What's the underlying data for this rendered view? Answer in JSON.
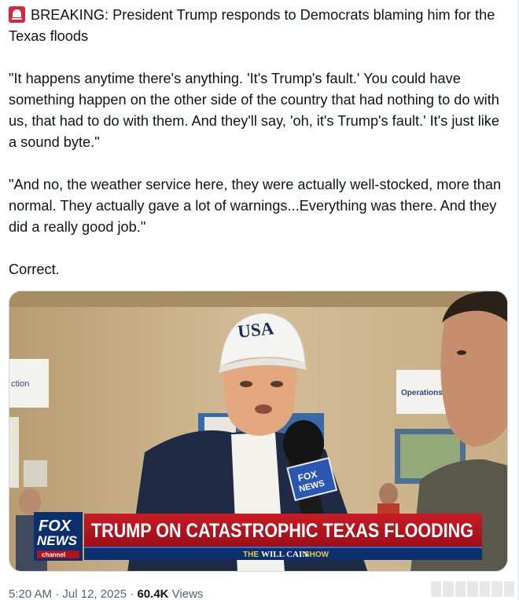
{
  "tweet": {
    "headline": "BREAKING: President Trump responds to Democrats blaming him for the Texas floods",
    "quote_1": "\"It happens anytime there's anything. 'It's Trump's fault.' You could have something happen on the other side of the country that had nothing to do with us, that had to do with them. And they'll say, 'oh, it's Trump's fault.' It's just like a sound byte.\"",
    "quote_2": "\"And no, the weather service here, they were actually well-stocked, more than normal. They actually gave a lot of warnings...Everything was there. And they did a really good job.\"",
    "closing": "Correct.",
    "icon": "siren-icon"
  },
  "media": {
    "type": "video-frame",
    "cap_text": "USA",
    "wall_sign_left": "ction",
    "wall_sign_right": "Operations Se",
    "mic_flag_text_1": "FOX",
    "mic_flag_text_2": "NEWS",
    "network_logo_line_1": "FOX",
    "network_logo_line_2": "NEWS",
    "network_logo_line_3": "channel",
    "chyron_headline": "TRUMP ON CATASTROPHIC TEXAS FLOODING",
    "chyron_show_prefix": "THE",
    "chyron_show_name": "WILL CAIN",
    "chyron_show_suffix": "SHOW",
    "colors": {
      "chyron_red": "#b1121c",
      "chyron_navy": "#0c2f6e",
      "chyron_blue": "#2b6fd6"
    }
  },
  "meta": {
    "time": "5:20 AM",
    "separator": "·",
    "date": "Jul 12, 2025",
    "views_count": "60.4K",
    "views_label": "Views"
  }
}
